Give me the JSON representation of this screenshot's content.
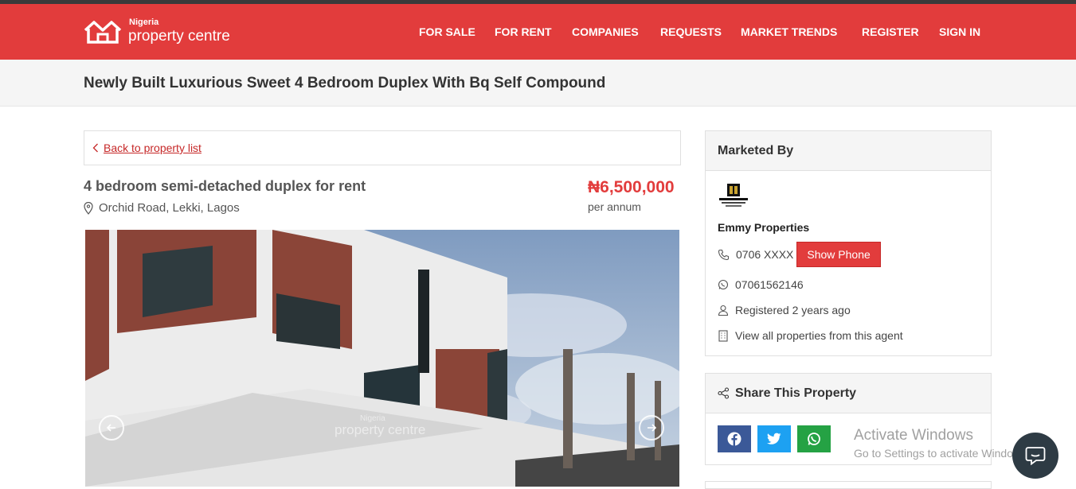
{
  "brand": {
    "small": "Nigeria",
    "big": "property centre",
    "color": "#e23c3c"
  },
  "nav": {
    "items": [
      "FOR SALE",
      "FOR RENT",
      "COMPANIES",
      "REQUESTS",
      "MARKET TRENDS",
      "REGISTER",
      "SIGN IN"
    ]
  },
  "page_title": "Newly Built Luxurious Sweet 4 Bedroom Duplex With Bq Self Compound",
  "back_link": "Back to property list",
  "listing": {
    "title": "4 bedroom semi-detached duplex for rent",
    "location": "Orchid Road, Lekki, Lagos",
    "price": "₦6,500,000",
    "period": "per annum"
  },
  "photo": {
    "watermark_small": "Nigeria",
    "watermark_big": "property centre"
  },
  "marketer": {
    "heading": "Marketed By",
    "logo_text": "EMMY OF LAGOS PROPERTIES",
    "name": "Emmy Properties",
    "phone_masked": "0706 XXXX",
    "show_phone_label": "Show Phone",
    "whatsapp": "07061562146",
    "registered": "Registered 2 years ago",
    "view_all": "View all properties from this agent"
  },
  "share": {
    "heading": "Share This Property",
    "buttons": [
      {
        "icon": "facebook-icon",
        "color": "#3b5998"
      },
      {
        "icon": "twitter-icon",
        "color": "#1da1f2"
      },
      {
        "icon": "whatsapp-icon",
        "color": "#25a244"
      }
    ]
  },
  "os_overlay": {
    "line1": "Activate Windows",
    "line2": "Go to Settings to activate Windows."
  },
  "chat": {
    "icon": "chat-icon"
  }
}
